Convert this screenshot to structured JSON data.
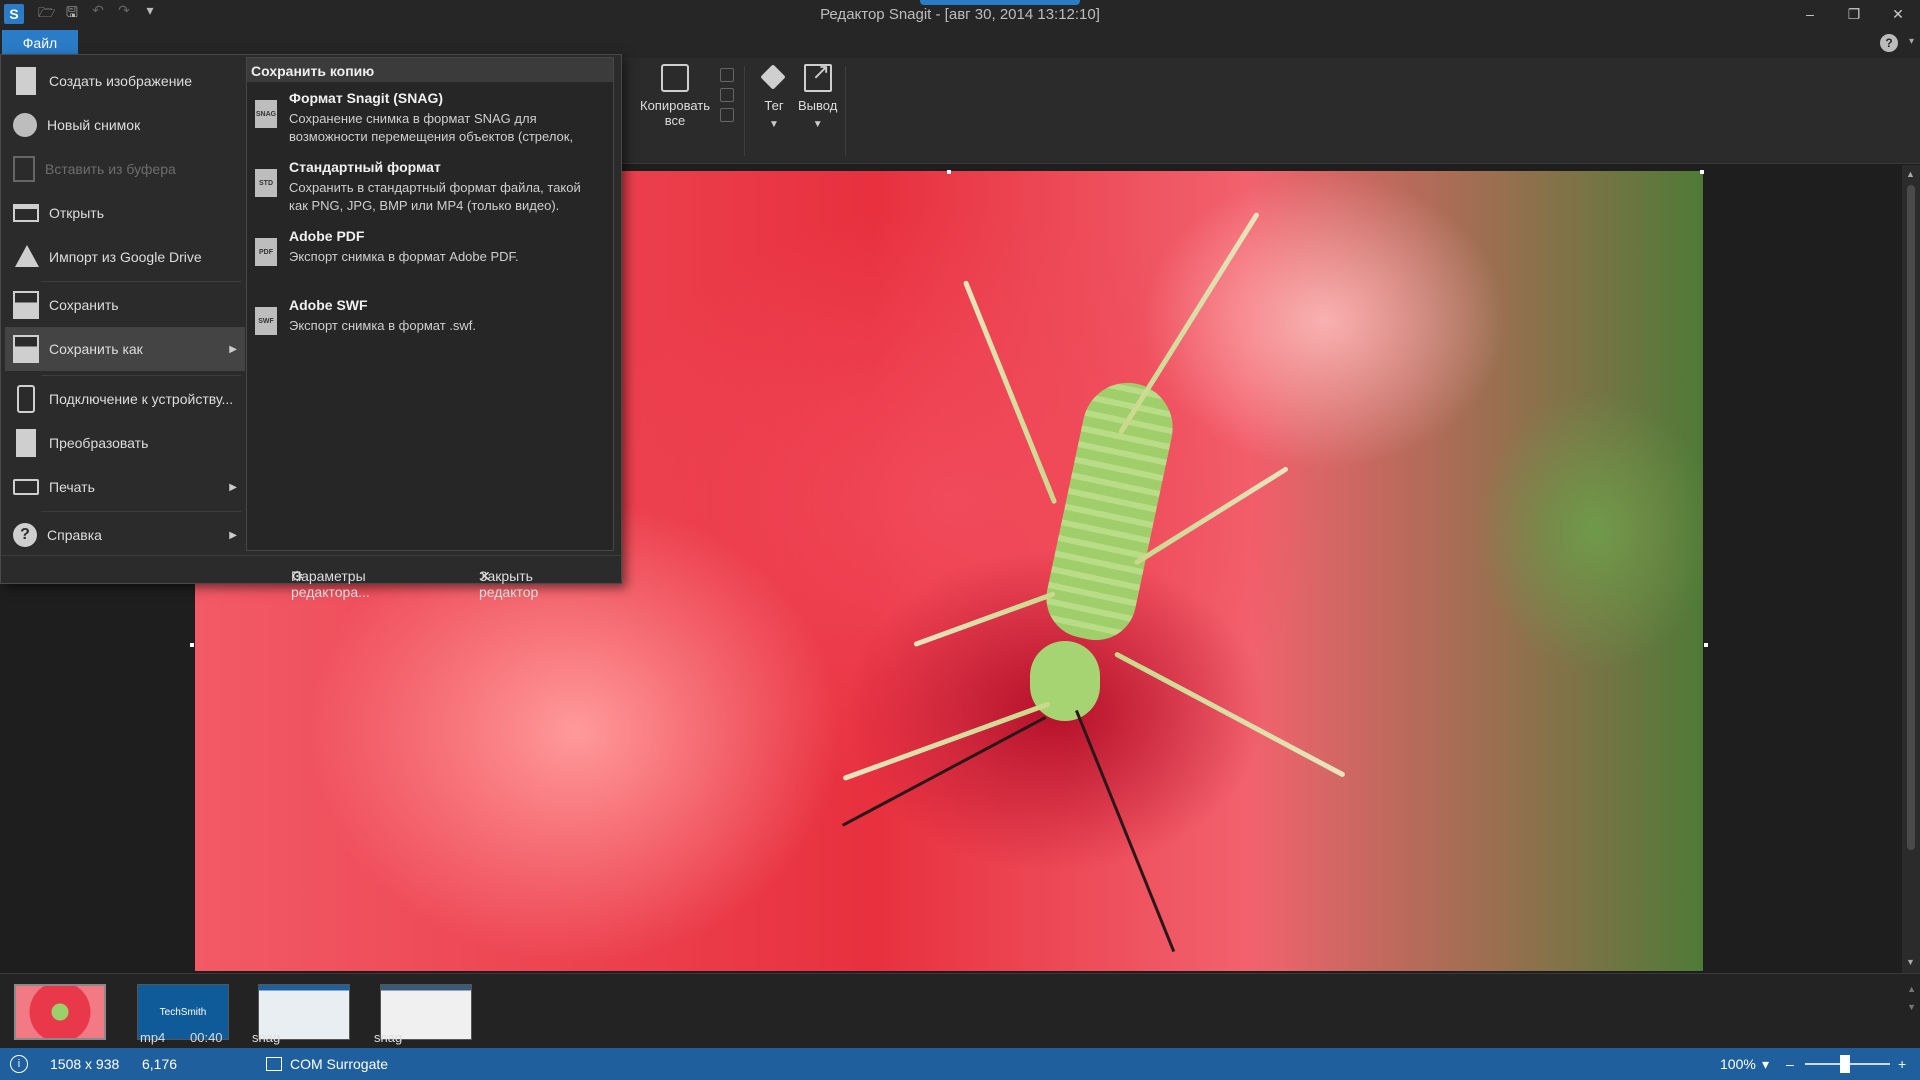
{
  "window": {
    "app_logo": "S",
    "title": "Редактор Snagit - [авг 30, 2014 13:12:10]",
    "controls": {
      "minimize": "–",
      "restore": "❐",
      "close": "✕"
    }
  },
  "quick_access": {
    "open": "🗁",
    "save": "🖫",
    "undo": "↶",
    "redo": "↷",
    "more": "▾"
  },
  "menubar": {
    "file_tab": "Файл",
    "help_icon": "?",
    "help_caret": "▾"
  },
  "ribbon": {
    "copy_all_label": "Копировать\nвсе",
    "tag_label": "Тег",
    "output_label": "Вывод",
    "caret": "▼"
  },
  "file_menu": {
    "items": [
      {
        "label": "Создать изображение",
        "icon": "new-image-icon"
      },
      {
        "label": "Новый снимок",
        "icon": "capture-circle-icon"
      },
      {
        "label": "Вставить из буфера",
        "icon": "clipboard-icon",
        "disabled": true
      },
      {
        "label": "Открыть",
        "icon": "folder-icon"
      },
      {
        "label": "Импорт из Google Drive",
        "icon": "google-drive-icon"
      },
      {
        "label": "Сохранить",
        "icon": "save-icon"
      },
      {
        "label": "Сохранить как",
        "icon": "save-as-icon",
        "submenu": true,
        "active": true
      },
      {
        "label": "Подключение к устройству...",
        "icon": "phone-icon"
      },
      {
        "label": "Преобразовать",
        "icon": "convert-icon"
      },
      {
        "label": "Печать",
        "icon": "printer-icon",
        "submenu": true
      },
      {
        "label": "Справка",
        "icon": "help-icon",
        "submenu": true
      }
    ],
    "arrow": "▶",
    "submenu": {
      "header": "Сохранить копию",
      "items": [
        {
          "title": "Формат Snagit (SNAG)",
          "desc": "Сохранение снимка в формат SNAG для\nвозможности перемещения объектов (стрелок,",
          "badge": "SNAG"
        },
        {
          "title": "Стандартный формат",
          "desc": "Сохранить в стандартный формат файла, такой\nкак PNG, JPG, BMP или MP4 (только видео).",
          "badge": "STD"
        },
        {
          "title": "Adobe PDF",
          "desc": "Экспорт снимка в формат Adobe PDF.",
          "badge": "PDF"
        },
        {
          "title": "Adobe SWF",
          "desc": "Экспорт снимка в формат .swf.",
          "badge": "SWF"
        }
      ]
    },
    "footer": {
      "settings_icon": "⚙",
      "settings_label": "Параметры редактора...",
      "close_icon": "✕",
      "close_label": "Закрыть редактор"
    }
  },
  "tray": {
    "items": [
      {
        "type": "",
        "duration": ""
      },
      {
        "type": "mp4",
        "duration": "00:40",
        "caption": "TechSmith"
      },
      {
        "type": "snag",
        "duration": ""
      },
      {
        "type": "snag",
        "duration": ""
      }
    ],
    "scroll_up": "▲",
    "scroll_down": "▼"
  },
  "statusbar": {
    "info_icon": "i",
    "dimensions": "1508 x 938",
    "coords": "6,176",
    "com_label": "COM Surrogate",
    "zoom": "100%",
    "zoom_caret": "▾",
    "zoom_minus": "–",
    "zoom_plus": "+"
  },
  "colors": {
    "accent": "#2a7cc7",
    "statusbar": "#1f5f9e",
    "menu_bg": "#2b2b2b"
  }
}
